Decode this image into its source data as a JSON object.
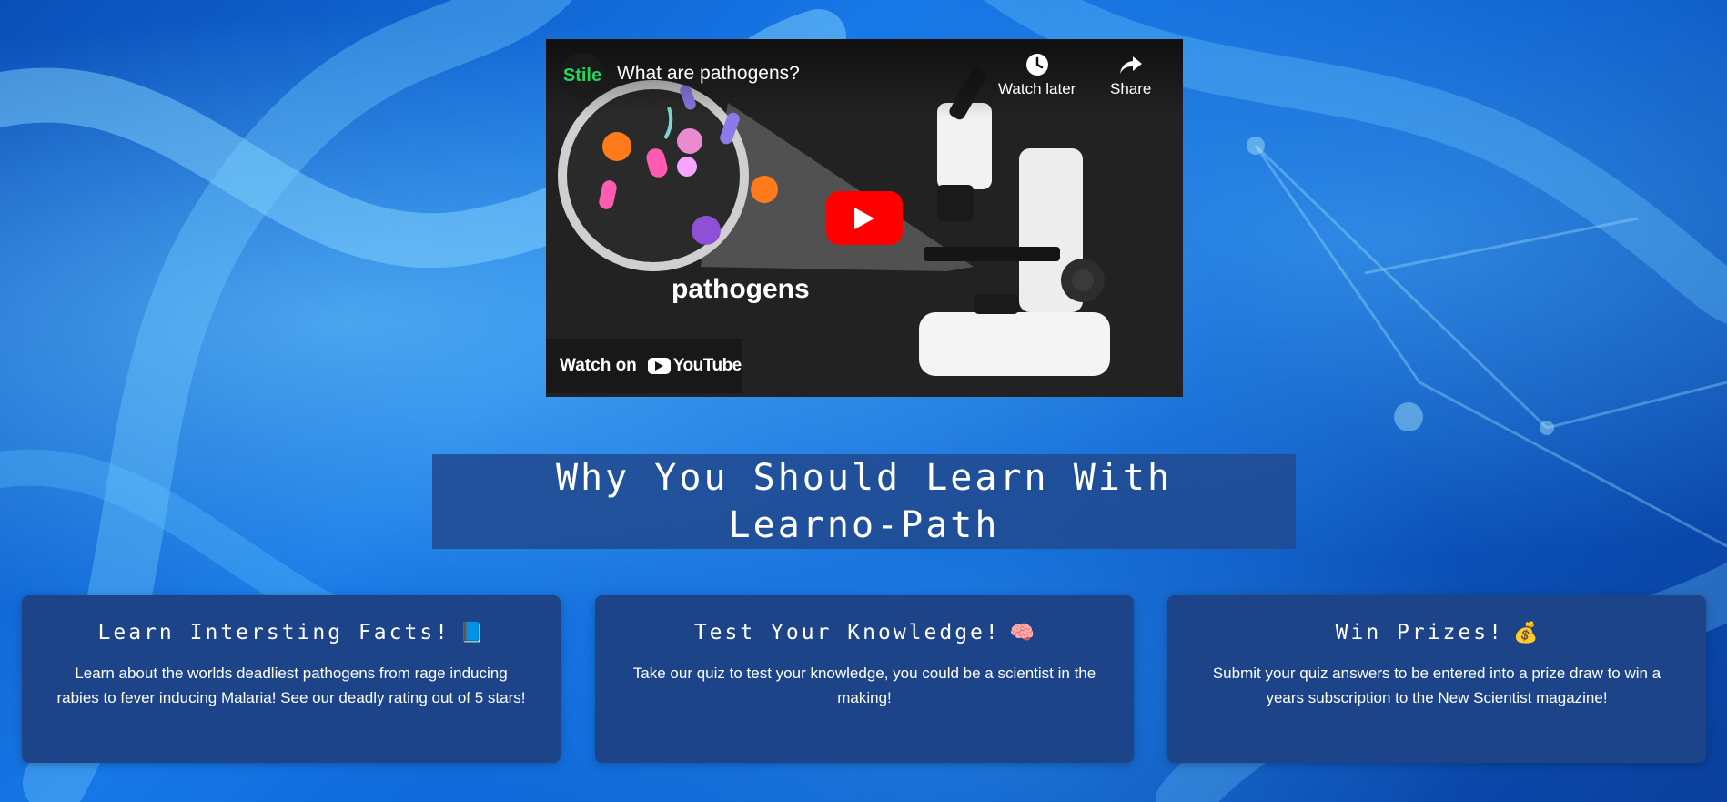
{
  "video": {
    "channel_logo_text": "Stile",
    "title": "What are pathogens?",
    "watch_later_label": "Watch later",
    "share_label": "Share",
    "caption": "pathogens",
    "watch_on_label": "Watch on",
    "youtube_label": "YouTube"
  },
  "why_section": {
    "title": "Why You Should Learn With Learno-Path"
  },
  "features": [
    {
      "title": "Learn Intersting Facts!",
      "icon": "book-icon",
      "icon_glyph": "📘",
      "text": "Learn about the worlds deadliest pathogens from rage inducing rabies to fever inducing Malaria! See our deadly rating out of 5 stars!"
    },
    {
      "title": "Test Your Knowledge!",
      "icon": "brain-icon",
      "icon_glyph": "🧠",
      "text": "Take our quiz to test your knowledge, you could be a scientist in the making!"
    },
    {
      "title": "Win Prizes!",
      "icon": "money-bag-icon",
      "icon_glyph": "💰",
      "text": "Submit your quiz answers to be entered into a prize draw to win a years subscription to the New Scientist magazine!"
    }
  ],
  "colors": {
    "card_background": "#1d4488",
    "heading_background": "#214a91",
    "youtube_red": "#ff0000",
    "channel_green": "#28d35c"
  }
}
